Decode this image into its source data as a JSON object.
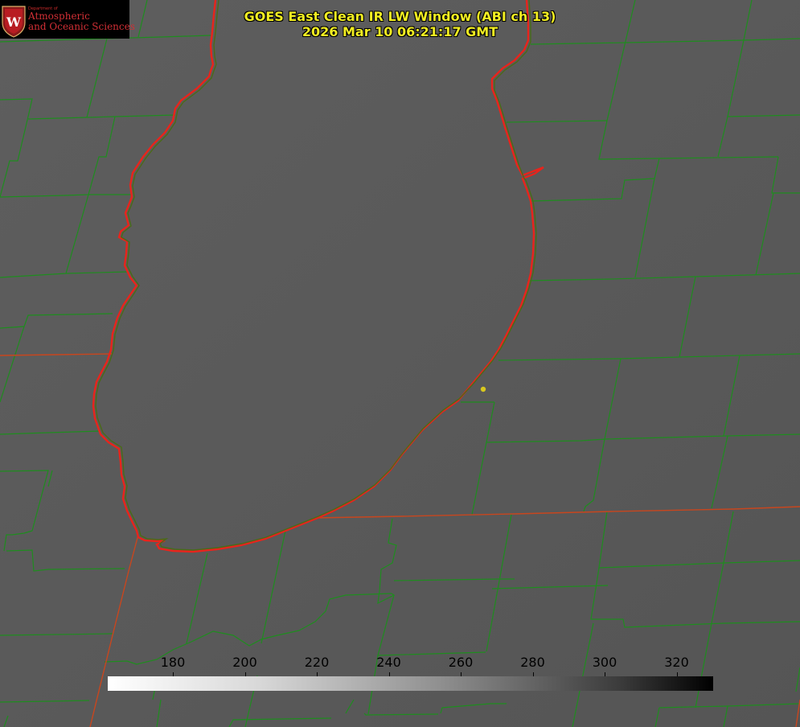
{
  "title": {
    "line1": "GOES East Clean IR LW Window (ABI ch 13)",
    "line2": "2026 Mar 10 06:21:17 GMT"
  },
  "logo": {
    "dept_small": "Department of",
    "line1": "Atmospheric",
    "line2": "and Oceanic Sciences",
    "emblem_letter": "W",
    "icon": "university-crest-icon"
  },
  "colorbar": {
    "ticks": [
      "180",
      "200",
      "220",
      "240",
      "260",
      "280",
      "300",
      "320"
    ]
  },
  "colors": {
    "title_text": "#f2ee22",
    "county_lines": "#1f8c1f",
    "state_lines": "#c8461e",
    "lake_outline": "#e8241c",
    "marker": "#d8c81e",
    "logo_red": "#d22f35"
  }
}
